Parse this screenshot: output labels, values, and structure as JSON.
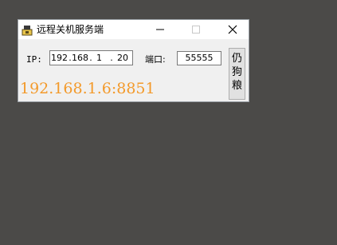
{
  "window": {
    "title": "远程关机服务端",
    "controls": {
      "minimize": "—",
      "maximize": "☐",
      "close": "✕"
    }
  },
  "form": {
    "ip_label": "IP:",
    "ip_segments": [
      "192",
      "168",
      "1",
      "20"
    ],
    "ip_separator": ".",
    "port_label": "端口:",
    "port_value": "55555",
    "action_button": "仍狗粮"
  },
  "status": {
    "address": "192.168.1.6:8851",
    "color": "#f39a2b"
  },
  "colors": {
    "desktop": "#4b4a48",
    "window_bg": "#f0f0f0"
  }
}
